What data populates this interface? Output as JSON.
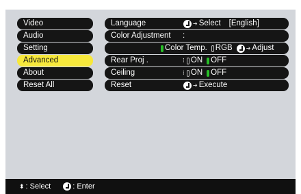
{
  "menu": [
    {
      "label": "Video"
    },
    {
      "label": "Audio"
    },
    {
      "label": "Setting"
    },
    {
      "label": "Advanced"
    },
    {
      "label": "About"
    },
    {
      "label": "Reset All"
    }
  ],
  "rows": {
    "language": {
      "label": "Language",
      "action": "Select",
      "value": "[English]"
    },
    "color_adjustment": {
      "label": "Color Adjustment",
      "separator": ":"
    },
    "color_options": {
      "opt1": "Color Temp.",
      "opt2": "RGB",
      "action": "Adjust"
    },
    "rear_proj": {
      "label": "Rear Proj .",
      "on": "ON",
      "off": "OFF"
    },
    "ceiling": {
      "label": "Ceiling",
      "on": "ON",
      "off": "OFF"
    },
    "reset": {
      "label": "Reset",
      "action": "Execute"
    }
  },
  "statusbar": {
    "select": ": Select",
    "enter": ": Enter"
  },
  "colors": {
    "active": "#f7e83c",
    "bar": "#151515",
    "screen": "#d3d6db",
    "indicator": "#28c028"
  }
}
